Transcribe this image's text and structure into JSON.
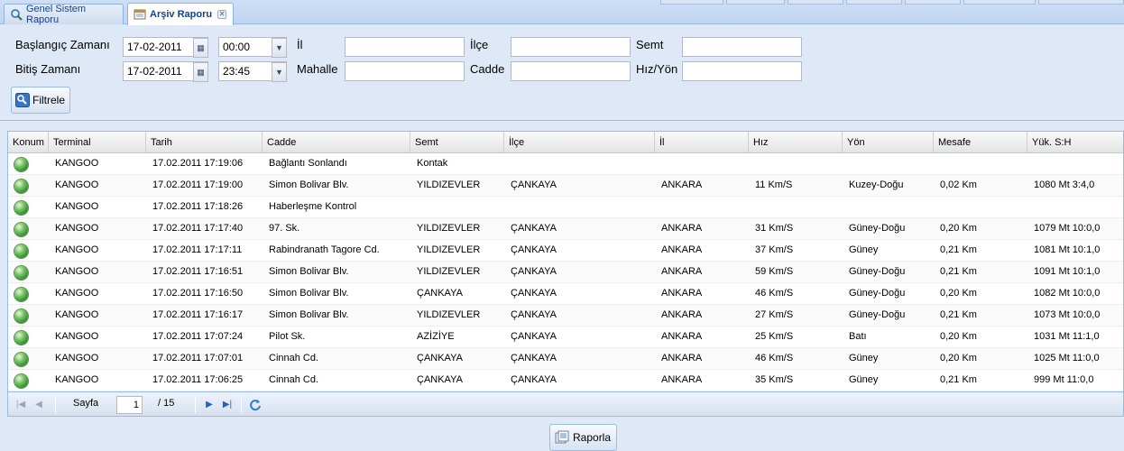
{
  "tabs": [
    {
      "label": "Genel Sistem Raporu",
      "icon": "magnifier-icon",
      "active": false
    },
    {
      "label": "Arşiv Raporu",
      "icon": "report-icon",
      "active": true
    }
  ],
  "filter": {
    "start_label": "Başlangıç Zamanı",
    "start_date": "17-02-2011",
    "start_time": "00:00",
    "end_label": "Bitiş Zamanı",
    "end_date": "17-02-2011",
    "end_time": "23:45",
    "il_label": "İl",
    "il_value": "",
    "mahalle_label": "Mahalle",
    "mahalle_value": "",
    "ilce_label": "İlçe",
    "ilce_value": "",
    "cadde_label": "Cadde",
    "cadde_value": "",
    "semt_label": "Semt",
    "semt_value": "",
    "hizyon_label": "Hız/Yön",
    "hizyon_value": "",
    "filter_button": "Filtrele"
  },
  "grid": {
    "columns": [
      "Konum",
      "Terminal",
      "Tarih",
      "Cadde",
      "Semt",
      "İlçe",
      "İl",
      "Hız",
      "Yön",
      "Mesafe",
      "Yük. S:H"
    ],
    "rows": [
      [
        "",
        "KANGOO",
        "17.02.2011 17:19:06",
        "Bağlantı Sonlandı",
        "Kontak",
        "",
        "",
        "",
        "",
        "",
        ""
      ],
      [
        "",
        "KANGOO",
        "17.02.2011 17:19:00",
        "Simon Bolivar Blv.",
        "YILDIZEVLER",
        "ÇANKAYA",
        "ANKARA",
        "11 Km/S",
        "Kuzey-Doğu",
        "0,02 Km",
        "1080 Mt 3:4,0"
      ],
      [
        "",
        "KANGOO",
        "17.02.2011 17:18:26",
        "Haberleşme Kontrol",
        "",
        "",
        "",
        "",
        "",
        "",
        ""
      ],
      [
        "",
        "KANGOO",
        "17.02.2011 17:17:40",
        "97. Sk.",
        "YILDIZEVLER",
        "ÇANKAYA",
        "ANKARA",
        "31 Km/S",
        "Güney-Doğu",
        "0,20 Km",
        "1079 Mt 10:0,0"
      ],
      [
        "",
        "KANGOO",
        "17.02.2011 17:17:11",
        "Rabindranath Tagore Cd.",
        "YILDIZEVLER",
        "ÇANKAYA",
        "ANKARA",
        "37 Km/S",
        "Güney",
        "0,21 Km",
        "1081 Mt 10:1,0"
      ],
      [
        "",
        "KANGOO",
        "17.02.2011 17:16:51",
        "Simon Bolivar Blv.",
        "YILDIZEVLER",
        "ÇANKAYA",
        "ANKARA",
        "59 Km/S",
        "Güney-Doğu",
        "0,21 Km",
        "1091 Mt 10:1,0"
      ],
      [
        "",
        "KANGOO",
        "17.02.2011 17:16:50",
        "Simon Bolivar Blv.",
        "ÇANKAYA",
        "ÇANKAYA",
        "ANKARA",
        "46 Km/S",
        "Güney-Doğu",
        "0,20 Km",
        "1082 Mt 10:0,0"
      ],
      [
        "",
        "KANGOO",
        "17.02.2011 17:16:17",
        "Simon Bolivar Blv.",
        "YILDIZEVLER",
        "ÇANKAYA",
        "ANKARA",
        "27 Km/S",
        "Güney-Doğu",
        "0,21 Km",
        "1073 Mt 10:0,0"
      ],
      [
        "",
        "KANGOO",
        "17.02.2011 17:07:24",
        "Pilot Sk.",
        "AZİZİYE",
        "ÇANKAYA",
        "ANKARA",
        "25 Km/S",
        "Batı",
        "0,20 Km",
        "1031 Mt 11:1,0"
      ],
      [
        "",
        "KANGOO",
        "17.02.2011 17:07:01",
        "Cinnah Cd.",
        "ÇANKAYA",
        "ÇANKAYA",
        "ANKARA",
        "46 Km/S",
        "Güney",
        "0,20 Km",
        "1025 Mt 11:0,0"
      ],
      [
        "",
        "KANGOO",
        "17.02.2011 17:06:25",
        "Cinnah Cd.",
        "ÇANKAYA",
        "ÇANKAYA",
        "ANKARA",
        "35 Km/S",
        "Güney",
        "0,21 Km",
        "999 Mt 11:0,0"
      ]
    ]
  },
  "pager": {
    "page_label": "Sayfa",
    "page_value": "1",
    "total": "/ 15"
  },
  "report_button": "Raporla",
  "colors": {
    "panel_bg": "#dfe8f6",
    "border": "#99bbe8",
    "tab_text": "#15428b"
  }
}
